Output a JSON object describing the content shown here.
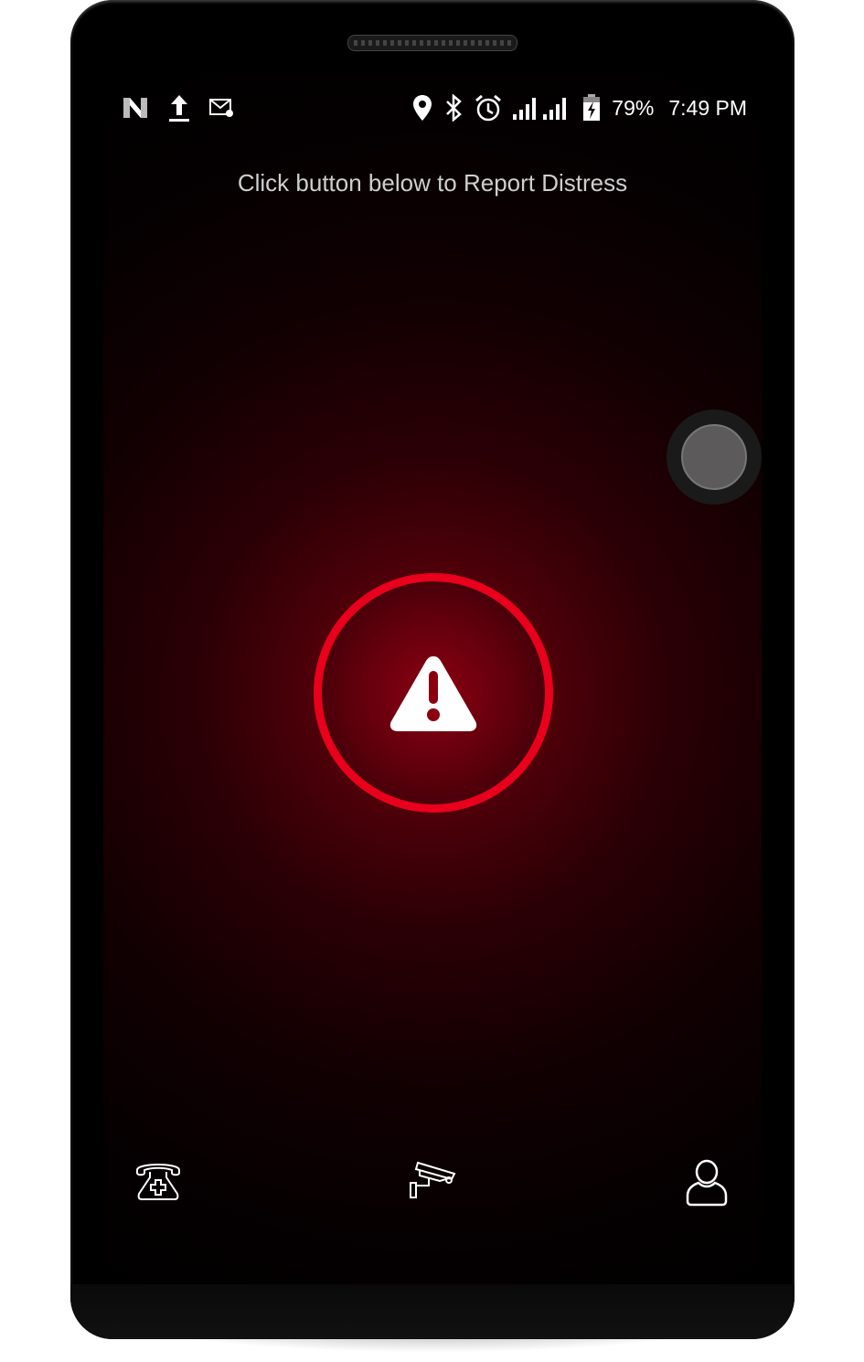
{
  "status_bar": {
    "left_icons": [
      "n-notification-icon",
      "upload-icon",
      "mail-settings-icon"
    ],
    "right_icons": [
      "location-icon",
      "bluetooth-icon",
      "alarm-icon",
      "signal-icon",
      "signal-icon",
      "battery-charging-icon"
    ],
    "battery": "79%",
    "time": "7:49 PM"
  },
  "main": {
    "prompt": "Click button below to Report Distress",
    "accent_color": "#e8001c"
  },
  "bottom_nav": [
    "emergency-call-icon",
    "cctv-camera-icon",
    "profile-icon"
  ]
}
